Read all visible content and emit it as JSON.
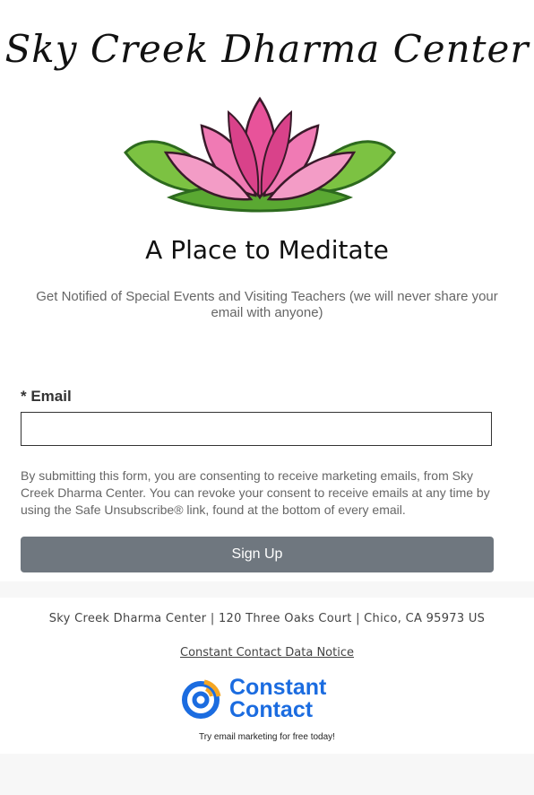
{
  "header": {
    "org_name": "Sky Creek Dharma Center",
    "tagline": "A Place to Meditate",
    "intro_text": "Get Notified of Special Events and Visiting Teachers (we will never share your email with anyone)",
    "logo_icon": "lotus-flower-icon"
  },
  "form": {
    "email_label": "* Email",
    "email_value": "",
    "email_placeholder": "",
    "consent_text": "By submitting this form, you are consenting to receive marketing emails, from Sky Creek Dharma Center. You can revoke your consent to receive emails at any time by using the Safe Unsubscribe® link, found at the bottom of every email.",
    "submit_label": "Sign Up",
    "submit_color": "#6f777f"
  },
  "footer": {
    "address": "Sky Creek Dharma Center | 120 Three Oaks Court | Chico, CA 95973 US",
    "notice_link": "Constant Contact Data Notice",
    "brand_line1": "Constant",
    "brand_line2": "Contact",
    "brand_color": "#1b6ce0",
    "promo": "Try email marketing for free today!"
  }
}
